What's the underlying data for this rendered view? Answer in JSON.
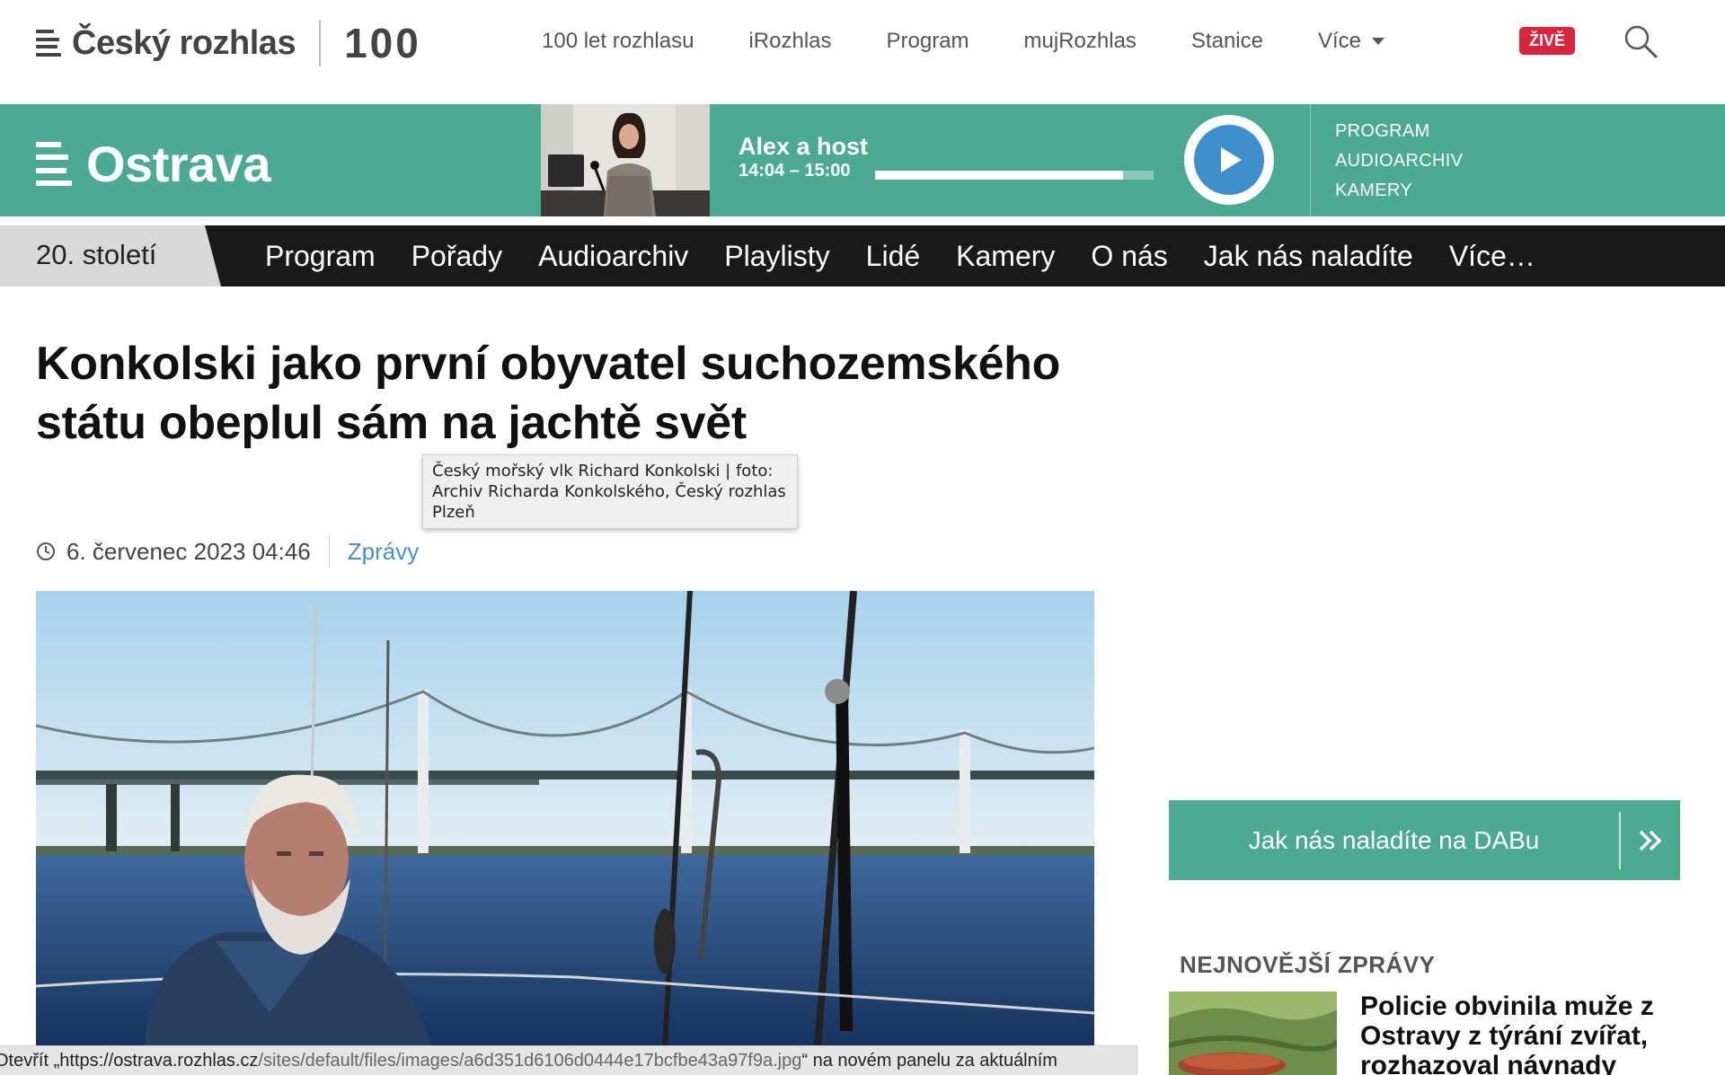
{
  "header": {
    "brand": "Český rozhlas",
    "anniversary_mark": "100",
    "nav": [
      "100 let rozhlasu",
      "iRozhlas",
      "Program",
      "mujRozhlas",
      "Stanice"
    ],
    "more_label": "Více",
    "live_label": "ŽIVĚ"
  },
  "station": {
    "name": "Ostrava",
    "now_playing": {
      "title": "Alex a host",
      "time": "14:04 – 15:00",
      "progress": 0.89
    },
    "links": [
      "PROGRAM",
      "AUDIOARCHIV",
      "KAMERY"
    ]
  },
  "section_nav": {
    "tag": "20. století",
    "items": [
      "Program",
      "Pořady",
      "Audioarchiv",
      "Playlisty",
      "Lidé",
      "Kamery",
      "O nás",
      "Jak nás naladíte",
      "Více…"
    ]
  },
  "article": {
    "headline": "Konkolski jako první obyvatel suchozemského státu obeplul sám na jachtě svět",
    "date": "6. červenec 2023 04:46",
    "category": "Zprávy",
    "image_tooltip": "Český mořský vlk Richard Konkolski | foto: Archiv Richarda Konkolského,  Český rozhlas Plzeň"
  },
  "sidebar": {
    "dab_label": "Jak nás naladíte na DABu",
    "news_heading": "NEJNOVĚJŠÍ ZPRÁVY",
    "news_item_title": "Policie obvinila muže z Ostravy z týrání zvířat, rozhazoval návnady"
  },
  "statusbar": {
    "prefix": "Otevřít „",
    "url_host": "https://ostrava.rozhlas.cz",
    "url_path": "/sites/default/files/images/a6d351d6106d0444e17bcfbe43a97f9a.jpg",
    "suffix": "“ na novém panelu za aktuálním"
  },
  "colors": {
    "brand_green": "#4ca994",
    "live_red": "#d7263d",
    "link_blue": "#4a90c8",
    "nav_dark": "#1a1a1a"
  }
}
